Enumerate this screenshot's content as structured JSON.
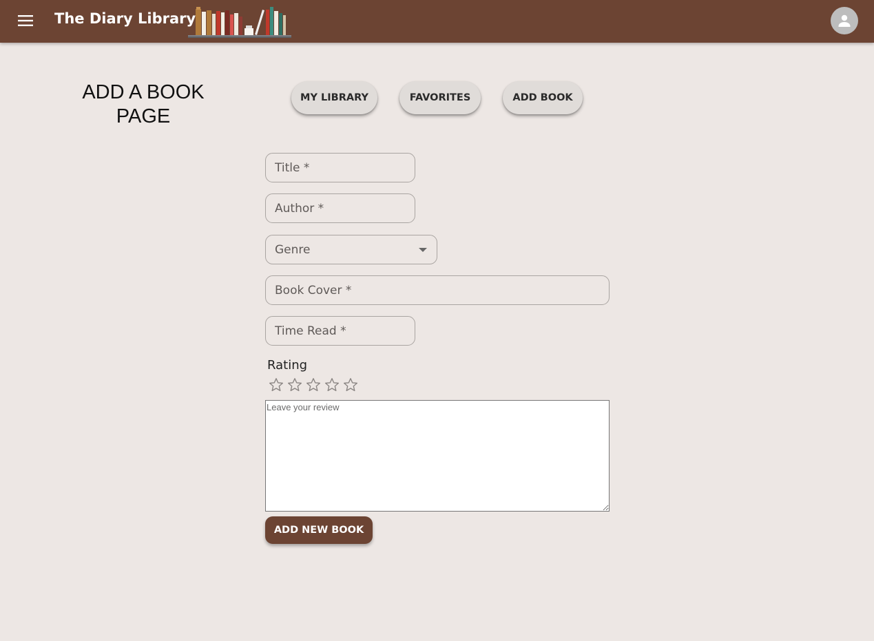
{
  "appbar": {
    "title": "The Diary Library",
    "menu_icon": "hamburger-menu-icon",
    "logo_icon": "bookshelf-logo",
    "avatar_icon": "person-icon",
    "background": "#6c4433"
  },
  "page": {
    "title": "ADD A BOOK PAGE",
    "background": "#ede7e4"
  },
  "nav": {
    "my_library": "MY LIBRARY",
    "favorites": "FAVORITES",
    "add_book": "ADD BOOK"
  },
  "form": {
    "title_placeholder": "Title *",
    "author_placeholder": "Author *",
    "genre_label": "Genre",
    "book_cover_placeholder": "Book Cover *",
    "time_read_placeholder": "Time Read *",
    "rating_label": "Rating",
    "rating_value": 0,
    "rating_max": 5,
    "review_placeholder": "Leave your review",
    "submit_label": "ADD NEW BOOK"
  }
}
